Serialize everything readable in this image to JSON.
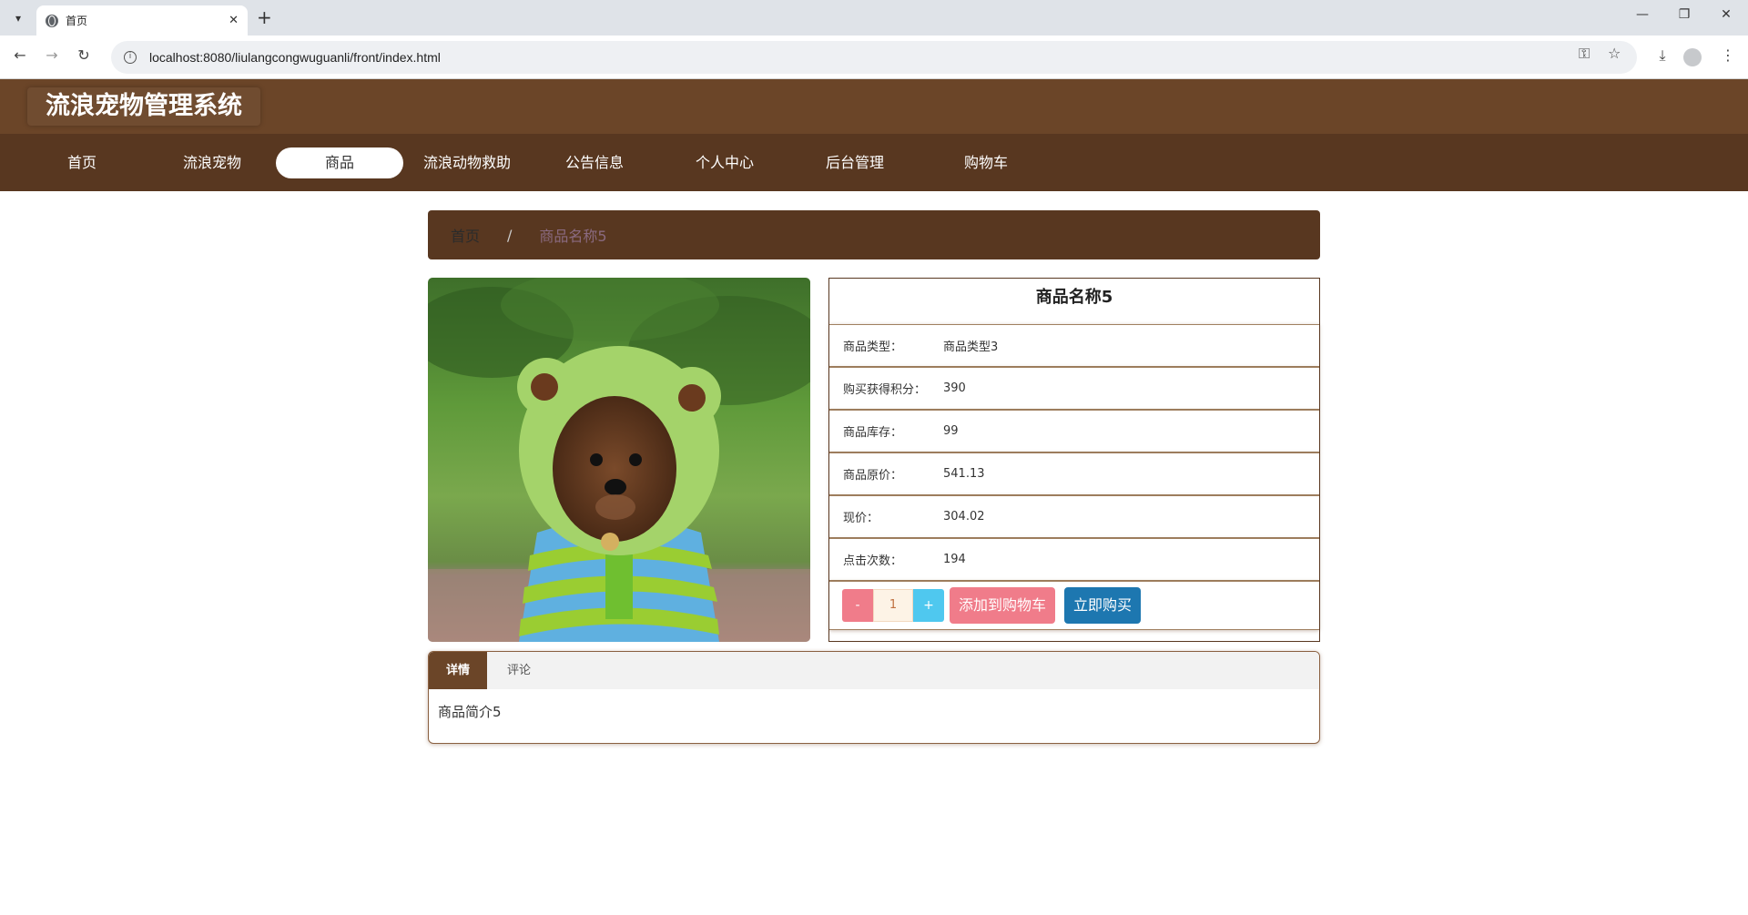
{
  "browser": {
    "tab_title": "首页",
    "url": "localhost:8080/liulangcongwuguanli/front/index.html"
  },
  "site": {
    "title": "流浪宠物管理系统"
  },
  "nav": {
    "items": [
      {
        "label": "首页"
      },
      {
        "label": "流浪宠物"
      },
      {
        "label": "商品"
      },
      {
        "label": "流浪动物救助"
      },
      {
        "label": "公告信息"
      },
      {
        "label": "个人中心"
      },
      {
        "label": "后台管理"
      },
      {
        "label": "购物车"
      }
    ],
    "active_index": 2
  },
  "breadcrumb": {
    "home": "首页",
    "separator": "/",
    "current": "商品名称5"
  },
  "product": {
    "name": "商品名称5",
    "rows": [
      {
        "label": "商品类型：",
        "value": "商品类型3"
      },
      {
        "label": "购买获得积分：",
        "value": "390"
      },
      {
        "label": "商品库存：",
        "value": "99"
      },
      {
        "label": "商品原价：",
        "value": "541.13"
      },
      {
        "label": "现价：",
        "value": "304.02"
      },
      {
        "label": "点击次数：",
        "value": "194"
      }
    ],
    "quantity": "1",
    "minus_label": "-",
    "plus_label": "+",
    "add_cart_label": "添加到购物车",
    "buy_now_label": "立即购买"
  },
  "tabs": {
    "detail_label": "详情",
    "comment_label": "评论",
    "detail_text": "商品简介5"
  },
  "colors": {
    "header": "#6b4528",
    "navbar": "#583720",
    "cart_button": "#f07c8a",
    "buy_button": "#1d77b0",
    "plus_button": "#4fc8ef"
  }
}
